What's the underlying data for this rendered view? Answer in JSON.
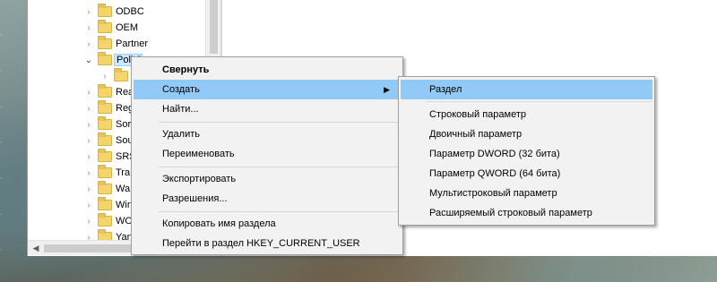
{
  "tree": {
    "items": [
      {
        "label": "ODBC",
        "expanded": false
      },
      {
        "label": "OEM",
        "expanded": false
      },
      {
        "label": "Partner",
        "expanded": false
      },
      {
        "label": "Polici",
        "expanded": true,
        "selected": true
      },
      {
        "label": "",
        "expanded": false
      },
      {
        "label": "Rea",
        "expanded": false
      },
      {
        "label": "Reg",
        "expanded": false
      },
      {
        "label": "Sor",
        "expanded": false
      },
      {
        "label": "Sou",
        "expanded": false
      },
      {
        "label": "SRS",
        "expanded": false
      },
      {
        "label": "Tra",
        "expanded": false
      },
      {
        "label": "Wa",
        "expanded": false
      },
      {
        "label": "Win",
        "expanded": false
      },
      {
        "label": "WO",
        "expanded": false
      },
      {
        "label": "Yan",
        "expanded": false
      }
    ]
  },
  "context_menu": {
    "collapse": "Свернуть",
    "new": "Создать",
    "find": "Найти...",
    "delete": "Удалить",
    "rename": "Переименовать",
    "export": "Экспортировать",
    "permissions": "Разрешения...",
    "copy_key_name": "Копировать имя раздела",
    "goto_hkcu": "Перейти в раздел HKEY_CURRENT_USER"
  },
  "submenu": {
    "key": "Раздел",
    "string_value": "Строковый параметр",
    "binary_value": "Двоичный параметр",
    "dword_value": "Параметр DWORD (32 бита)",
    "qword_value": "Параметр QWORD (64 бита)",
    "multi_string_value": "Мультистроковый параметр",
    "expandable_string_value": "Расширяемый строковый параметр"
  },
  "colors": {
    "menu_background": "#f2f2f2",
    "menu_highlight": "#91c9f7",
    "folder": "#f5d46b",
    "selection": "#cce8ff"
  }
}
